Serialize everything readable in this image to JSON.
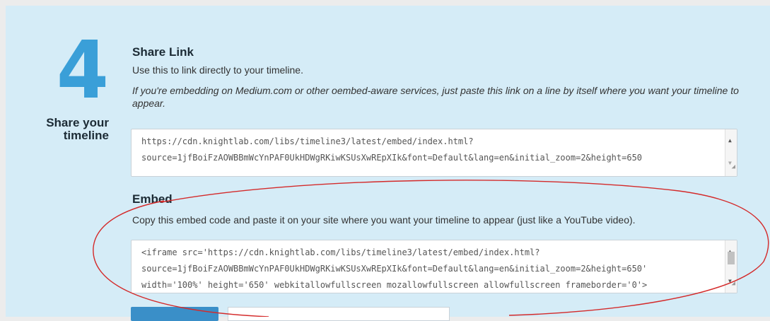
{
  "step": {
    "number": "4",
    "title": "Share your timeline"
  },
  "share_link": {
    "heading": "Share Link",
    "description": "Use this to link directly to your timeline.",
    "note": "If you're embedding on Medium.com or other oembed-aware services, just paste this link on a line by itself where you want your timeline to appear.",
    "url_line1": "https://cdn.knightlab.com/libs/timeline3/latest/embed/index.html?",
    "url_line2": "source=1jfBoiFzAOWBBmWcYnPAF0UkHDWgRKiwKSUsXwREpXIk&font=Default&lang=en&initial_zoom=2&height=650"
  },
  "embed": {
    "heading": "Embed",
    "description": "Copy this embed code and paste it on your site where you want your timeline to appear (just like a YouTube video).",
    "code_line1": "<iframe src='https://cdn.knightlab.com/libs/timeline3/latest/embed/index.html?",
    "code_line2": "source=1jfBoiFzAOWBBmWcYnPAF0UkHDWgRKiwKSUsXwREpXIk&font=Default&lang=en&initial_zoom=2&height=650'",
    "code_line3": "width='100%' height='650' webkitallowfullscreen mozallowfullscreen allowfullscreen frameborder='0'>"
  },
  "colors": {
    "panel_background": "#d5ecf7",
    "accent_blue": "#3a9fd8",
    "annotation_red": "#d42a2a"
  }
}
